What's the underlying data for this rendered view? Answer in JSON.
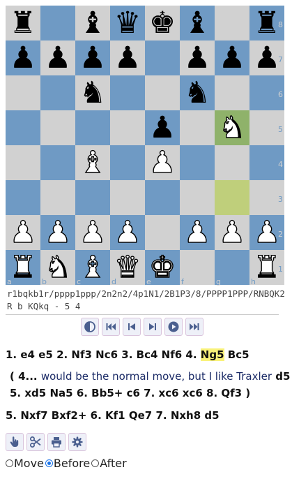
{
  "colors": {
    "light": "#d1d1d1",
    "dark": "#6f9ac4",
    "last_move_from": "#bfcf7b",
    "last_move_to": "#8fb26a",
    "button_icon": "#4a5f8f"
  },
  "board": {
    "rows": [
      [
        "r",
        "",
        "b",
        "q",
        "k",
        "b",
        "",
        "r"
      ],
      [
        "p",
        "p",
        "p",
        "p",
        "",
        "p",
        "p",
        "p"
      ],
      [
        "",
        "",
        "n",
        "",
        "",
        "n",
        "",
        ""
      ],
      [
        "",
        "",
        "",
        "",
        "p",
        "",
        "N",
        ""
      ],
      [
        "",
        "",
        "B",
        "",
        "P",
        "",
        "",
        ""
      ],
      [
        "",
        "",
        "",
        "",
        "",
        "",
        "",
        ""
      ],
      [
        "P",
        "P",
        "P",
        "P",
        "",
        "P",
        "P",
        "P"
      ],
      [
        "R",
        "N",
        "B",
        "Q",
        "K",
        "",
        "",
        "R"
      ]
    ],
    "highlight_from": "g3",
    "highlight_to": "g5",
    "files": [
      "a",
      "b",
      "c",
      "d",
      "e",
      "f",
      "g",
      "h"
    ],
    "ranks": [
      "8",
      "7",
      "6",
      "5",
      "4",
      "3",
      "2",
      "1"
    ]
  },
  "fen": "r1bqkb1r/pppp1ppp/2n2n2/4p1N1/2B1P3/8/PPPP1PPP/RNBQK2R b KQkq - 5 4",
  "nav_buttons": [
    {
      "name": "flip-board-icon",
      "icon": "half-circle"
    },
    {
      "name": "first-move-icon",
      "icon": "skip-back"
    },
    {
      "name": "prev-move-icon",
      "icon": "step-back"
    },
    {
      "name": "next-move-icon",
      "icon": "step-forward"
    },
    {
      "name": "play-icon",
      "icon": "play"
    },
    {
      "name": "last-move-icon",
      "icon": "skip-forward"
    }
  ],
  "moves": {
    "main": [
      "1. e4",
      "e5",
      "2. Nf3",
      "Nc6",
      "3. Bc4",
      "Nf6",
      "4.",
      "Ng5",
      "Bc5"
    ],
    "comment": {
      "open": "( 4...",
      "text": "would be the normal move, but I like Traxler",
      "line1_end": "d5",
      "line2": [
        "5. xd5",
        "Na5",
        "6. Bb5+",
        "c6",
        "7. xc6",
        "xc6",
        "8. Qf3",
        ")"
      ]
    },
    "continuation": [
      "5. Nxf7",
      "Bxf2+",
      "6. Kf1",
      "Qe7",
      "7. Nxh8",
      "d5"
    ]
  },
  "tools": [
    {
      "name": "hand-icon"
    },
    {
      "name": "scissors-icon"
    },
    {
      "name": "print-icon"
    },
    {
      "name": "gear-icon"
    }
  ],
  "modes": {
    "options": [
      "Move",
      "Before",
      "After"
    ],
    "selected": "Before"
  }
}
